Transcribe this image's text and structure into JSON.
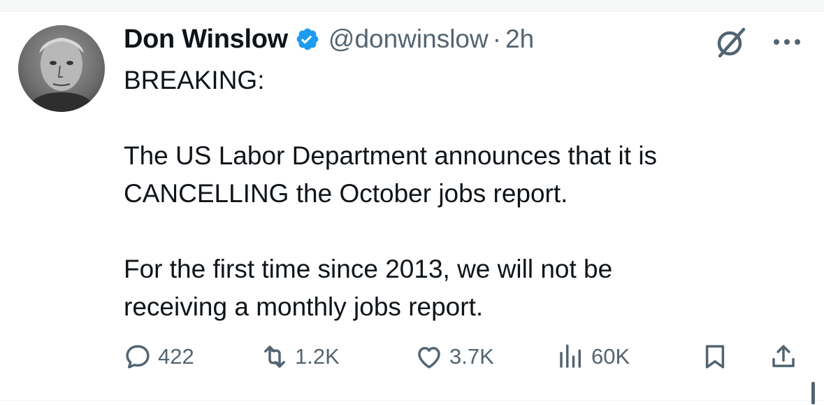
{
  "author": {
    "name": "Don Winslow",
    "handle": "@donwinslow",
    "separator": "·",
    "time": "2h",
    "verified": true,
    "verified_color": "#1d9bf0"
  },
  "tweet": {
    "lines_1": [
      "BREAKING:"
    ],
    "lines_2": [
      "The US Labor Department announces that it is",
      "CANCELLING the October jobs report."
    ],
    "lines_3": [
      "For the first time since 2013, we will not be",
      "receiving a monthly jobs report."
    ]
  },
  "actions": {
    "reply_count": "422",
    "retweet_count": "1.2K",
    "like_count": "3.7K",
    "views_count": "60K"
  },
  "icons": [
    "grok-icon",
    "more-icon",
    "reply-icon",
    "retweet-icon",
    "like-icon",
    "views-icon",
    "bookmark-icon",
    "share-icon"
  ],
  "colors": {
    "text": "#0f1419",
    "secondary": "#536471",
    "accent": "#1d9bf0"
  }
}
